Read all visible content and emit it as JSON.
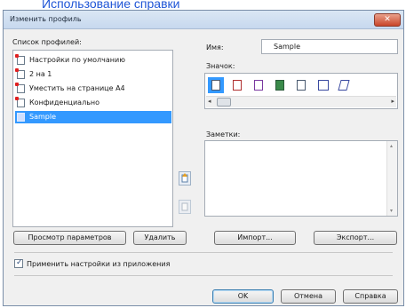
{
  "help_link": "Использование справки",
  "dialog": {
    "title": "Изменить профиль",
    "close": "✕"
  },
  "profiles": {
    "label": "Список профилей:",
    "items": [
      {
        "label": "Настройки по умолчанию",
        "modified": true
      },
      {
        "label": "2 на 1",
        "modified": true
      },
      {
        "label": "Уместить на странице A4",
        "modified": true
      },
      {
        "label": "Конфиденциально",
        "modified": true
      },
      {
        "label": "Sample",
        "modified": false,
        "selected": true
      }
    ]
  },
  "name": {
    "label": "Имя:",
    "value": "Sample"
  },
  "icon": {
    "label": "Значок:",
    "selected_index": 0
  },
  "notes": {
    "label": "Заметки:",
    "value": ""
  },
  "buttons": {
    "view_settings": "Просмотр параметров",
    "delete": "Удалить",
    "import": "Импорт...",
    "export": "Экспорт...",
    "ok": "OK",
    "cancel": "Отмена",
    "help": "Справка"
  },
  "apply_from_app": {
    "label": "Применить настройки из приложения",
    "checked": true
  },
  "colors": {
    "selection": "#3399ff",
    "modified_marker": "#e02020"
  }
}
